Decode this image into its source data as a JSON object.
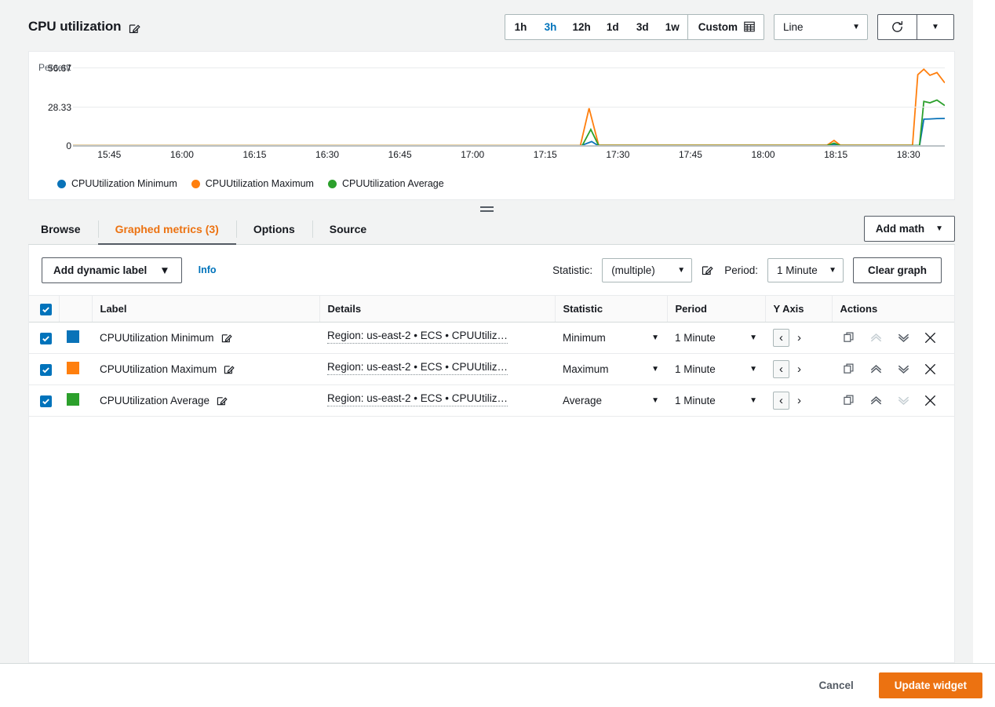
{
  "header": {
    "title": "CPU utilization",
    "edit_icon": "edit-pencil-icon",
    "ranges": [
      {
        "label": "1h",
        "active": false
      },
      {
        "label": "3h",
        "active": true
      },
      {
        "label": "12h",
        "active": false
      },
      {
        "label": "1d",
        "active": false
      },
      {
        "label": "3d",
        "active": false
      },
      {
        "label": "1w",
        "active": false
      }
    ],
    "custom_label": "Custom",
    "custom_icon": "calendar-icon",
    "graph_type": "Line",
    "refresh_icon": "refresh-icon",
    "refresh_caret": "chevron-down-icon"
  },
  "chart_data": {
    "type": "line",
    "title": "CPU utilization",
    "ylabel": "Percent",
    "xlabel": "",
    "ylim": [
      0,
      56.67
    ],
    "yticks": [
      0,
      28.33,
      56.67
    ],
    "ytick_labels": [
      "0",
      "28.33",
      "56.67"
    ],
    "grid": true,
    "legend_position": "bottom-left",
    "x": [
      "15:45",
      "16:00",
      "16:15",
      "16:30",
      "16:45",
      "17:00",
      "17:15",
      "17:30",
      "17:45",
      "18:00",
      "18:15",
      "18:30"
    ],
    "xtick_labels": [
      "15:45",
      "16:00",
      "16:15",
      "16:30",
      "16:45",
      "17:00",
      "17:15",
      "17:30",
      "17:45",
      "18:00",
      "18:15",
      "18:30"
    ],
    "series": [
      {
        "name": "CPUUtilization Minimum",
        "color": "#0a73b8",
        "points": [
          [
            0,
            0
          ],
          [
            57,
            0
          ],
          [
            58.2,
            0
          ],
          [
            59.5,
            3.2
          ],
          [
            60.3,
            0
          ],
          [
            61,
            0
          ],
          [
            86.5,
            0
          ],
          [
            87.3,
            1.2
          ],
          [
            88,
            0
          ],
          [
            96.6,
            0
          ],
          [
            97.1,
            0
          ],
          [
            97.6,
            19.5
          ],
          [
            98.3,
            19.7
          ],
          [
            99.1,
            20.0
          ],
          [
            100,
            20.1
          ]
        ]
      },
      {
        "name": "CPUUtilization Maximum",
        "color": "#ff7f0e",
        "points": [
          [
            0,
            0.3
          ],
          [
            57,
            0.3
          ],
          [
            58.2,
            0.3
          ],
          [
            59.2,
            27.5
          ],
          [
            60.3,
            0.6
          ],
          [
            61,
            0.6
          ],
          [
            86.5,
            0.6
          ],
          [
            87.3,
            4.0
          ],
          [
            88,
            0.6
          ],
          [
            96.3,
            0.6
          ],
          [
            96.9,
            52.0
          ],
          [
            97.6,
            56.0
          ],
          [
            98.3,
            51.5
          ],
          [
            99.1,
            53.5
          ],
          [
            100,
            46.0
          ]
        ]
      },
      {
        "name": "CPUUtilization Average",
        "color": "#2ca02c",
        "points": [
          [
            0,
            0.1
          ],
          [
            57,
            0.1
          ],
          [
            58.4,
            0.1
          ],
          [
            59.4,
            12.0
          ],
          [
            60.3,
            0.3
          ],
          [
            61,
            0.3
          ],
          [
            86.5,
            0.3
          ],
          [
            87.3,
            2.0
          ],
          [
            88,
            0.3
          ],
          [
            96.5,
            0.3
          ],
          [
            97.1,
            0.4
          ],
          [
            97.6,
            32.5
          ],
          [
            98.3,
            31.5
          ],
          [
            99.1,
            33.5
          ],
          [
            100,
            29.5
          ]
        ]
      }
    ],
    "legend": [
      {
        "label": "CPUUtilization Minimum",
        "color": "#0a73b8"
      },
      {
        "label": "CPUUtilization Maximum",
        "color": "#ff7f0e"
      },
      {
        "label": "CPUUtilization Average",
        "color": "#2ca02c"
      }
    ]
  },
  "tabs": [
    {
      "label": "Browse",
      "active": false
    },
    {
      "label": "Graphed metrics (3)",
      "active": true
    },
    {
      "label": "Options",
      "active": false
    },
    {
      "label": "Source",
      "active": false
    }
  ],
  "add_math_label": "Add math",
  "toolbar": {
    "dynamic_label": "Add dynamic label",
    "info_label": "Info",
    "statistic_label": "Statistic:",
    "statistic_value": "(multiple)",
    "statistic_edit_icon": "edit-pencil-icon",
    "period_label": "Period:",
    "period_value": "1 Minute",
    "clear_label": "Clear graph"
  },
  "table": {
    "columns": [
      "Label",
      "Details",
      "Statistic",
      "Period",
      "Y Axis",
      "Actions"
    ],
    "select_all_checked": true,
    "rows": [
      {
        "checked": true,
        "color": "#0a73b8",
        "label": "CPUUtilization Minimum",
        "details": "Region: us-east-2 • ECS • CPUUtiliz…",
        "statistic": "Minimum",
        "period": "1 Minute",
        "yaxis_left_selected": true,
        "move_up_enabled": false,
        "move_down_enabled": true
      },
      {
        "checked": true,
        "color": "#ff7f0e",
        "label": "CPUUtilization Maximum",
        "details": "Region: us-east-2 • ECS • CPUUtiliz…",
        "statistic": "Maximum",
        "period": "1 Minute",
        "yaxis_left_selected": true,
        "move_up_enabled": true,
        "move_down_enabled": true
      },
      {
        "checked": true,
        "color": "#2ca02c",
        "label": "CPUUtilization Average",
        "details": "Region: us-east-2 • ECS • CPUUtiliz…",
        "statistic": "Average",
        "period": "1 Minute",
        "yaxis_left_selected": true,
        "move_up_enabled": true,
        "move_down_enabled": false
      }
    ],
    "action_icons": [
      "duplicate-icon",
      "move-up-icon",
      "move-down-icon",
      "remove-icon"
    ],
    "yaxis_icons": [
      "chevron-left-icon",
      "chevron-right-icon"
    ]
  },
  "footer": {
    "cancel_label": "Cancel",
    "submit_label": "Update widget"
  },
  "colors": {
    "accent_orange": "#ec7211",
    "link_blue": "#0073bb",
    "border": "#aab7b8"
  }
}
